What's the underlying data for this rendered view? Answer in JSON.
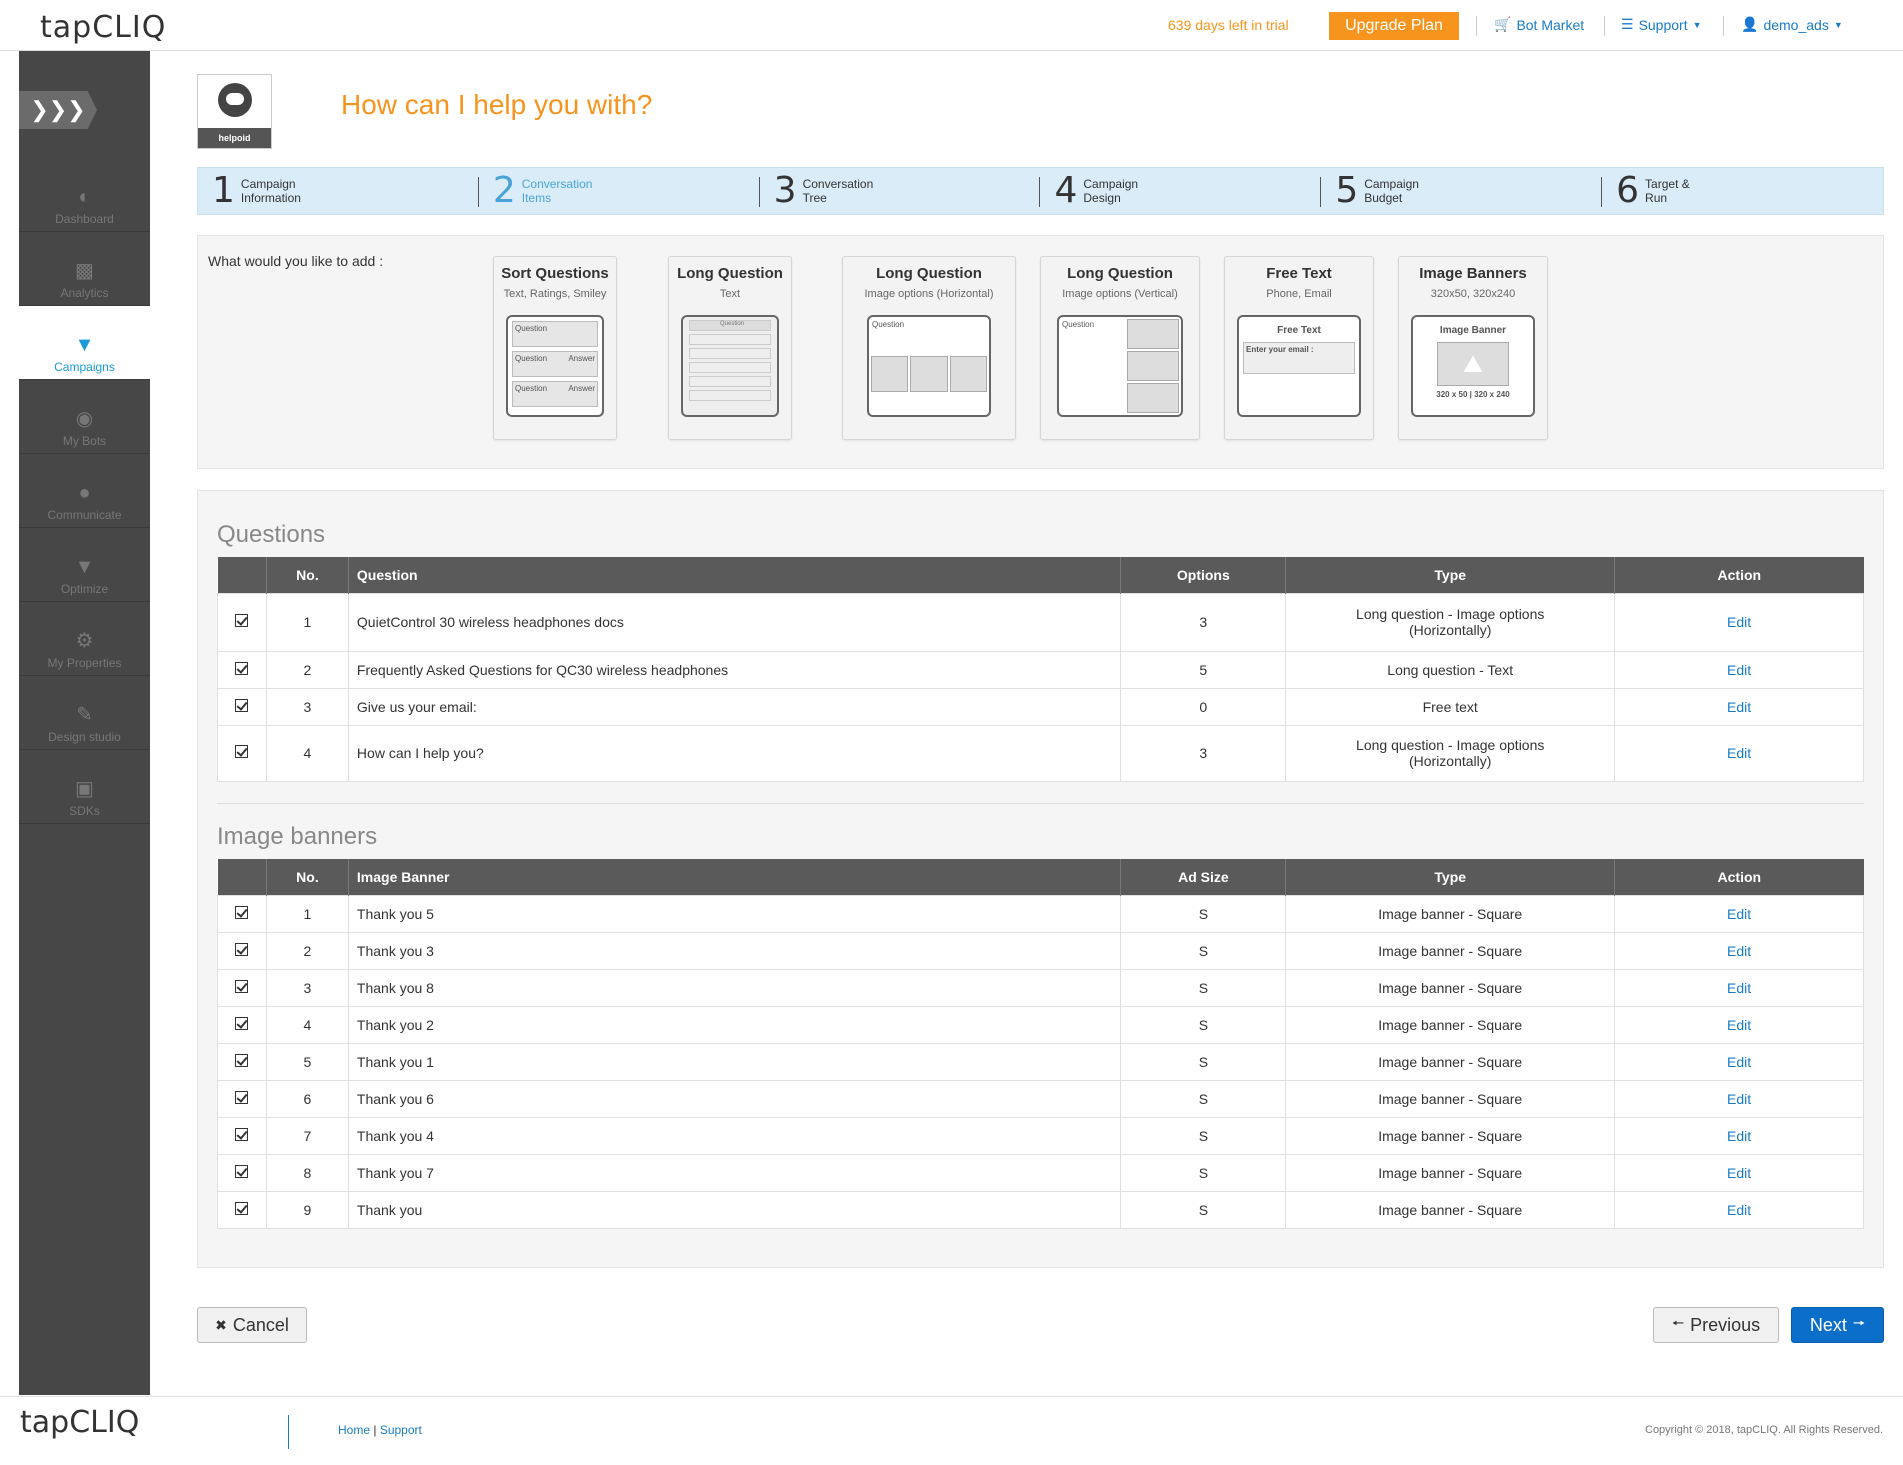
{
  "header": {
    "logo": "tapCLIQ",
    "trial_text": "639 days left in trial",
    "upgrade_label": "Upgrade Plan",
    "bot_market": "Bot Market",
    "support": "Support",
    "user": "demo_ads"
  },
  "sidebar": {
    "items": [
      {
        "label": "Dashboard",
        "icon": "dashboard-icon"
      },
      {
        "label": "Analytics",
        "icon": "analytics-icon"
      },
      {
        "label": "Campaigns",
        "icon": "campaigns-icon"
      },
      {
        "label": "My Bots",
        "icon": "bots-icon"
      },
      {
        "label": "Communicate",
        "icon": "communicate-icon"
      },
      {
        "label": "Optimize",
        "icon": "optimize-icon"
      },
      {
        "label": "My Properties",
        "icon": "properties-icon"
      },
      {
        "label": "Design studio",
        "icon": "design-icon"
      },
      {
        "label": "SDKs",
        "icon": "sdk-icon"
      }
    ]
  },
  "avatar": {
    "label": "helpoid"
  },
  "page_title": "How can I help you with?",
  "steps": [
    {
      "n": "1",
      "l1": "Campaign",
      "l2": "Information"
    },
    {
      "n": "2",
      "l1": "Conversation",
      "l2": "Items"
    },
    {
      "n": "3",
      "l1": "Conversation",
      "l2": "Tree"
    },
    {
      "n": "4",
      "l1": "Campaign",
      "l2": "Design"
    },
    {
      "n": "5",
      "l1": "Campaign",
      "l2": "Budget"
    },
    {
      "n": "6",
      "l1": "Target &",
      "l2": "Run"
    }
  ],
  "add": {
    "label": "What would you like to add :",
    "cards": [
      {
        "title": "Sort Questions",
        "sub": "Text, Ratings, Smiley"
      },
      {
        "title": "Long Question",
        "sub": "Text"
      },
      {
        "title": "Long Question",
        "sub": "Image options (Horizontal)"
      },
      {
        "title": "Long Question",
        "sub": "Image options (Vertical)"
      },
      {
        "title": "Free Text",
        "sub": "Phone, Email"
      },
      {
        "title": "Image Banners",
        "sub": "320x50, 320x240"
      }
    ],
    "thumb_text": {
      "question": "Question",
      "answer": "Answer",
      "free_text": "Free Text",
      "enter_email": "Enter your email :",
      "image_banner": "Image Banner",
      "banner_size": "320 x 50 | 320 x 240"
    }
  },
  "questions": {
    "title": "Questions",
    "headers": [
      "",
      "No.",
      "Question",
      "Options",
      "Type",
      "Action"
    ],
    "rows": [
      {
        "no": "1",
        "q": "QuietControl 30 wireless headphones docs",
        "opt": "3",
        "type": "Long question - Image options (Horizontally)",
        "action": "Edit"
      },
      {
        "no": "2",
        "q": "Frequently Asked Questions for QC30 wireless headphones",
        "opt": "5",
        "type": "Long question - Text",
        "action": "Edit"
      },
      {
        "no": "3",
        "q": "Give us your email:",
        "opt": "0",
        "type": "Free text",
        "action": "Edit"
      },
      {
        "no": "4",
        "q": "How can I help you?",
        "opt": "3",
        "type": "Long question - Image options (Horizontally)",
        "action": "Edit"
      }
    ]
  },
  "banners": {
    "title": "Image banners",
    "headers": [
      "",
      "No.",
      "Image Banner",
      "Ad Size",
      "Type",
      "Action"
    ],
    "rows": [
      {
        "no": "1",
        "name": "Thank you 5",
        "size": "S",
        "type": "Image banner - Square",
        "action": "Edit"
      },
      {
        "no": "2",
        "name": "Thank you 3",
        "size": "S",
        "type": "Image banner - Square",
        "action": "Edit"
      },
      {
        "no": "3",
        "name": "Thank you 8",
        "size": "S",
        "type": "Image banner - Square",
        "action": "Edit"
      },
      {
        "no": "4",
        "name": "Thank you 2",
        "size": "S",
        "type": "Image banner - Square",
        "action": "Edit"
      },
      {
        "no": "5",
        "name": "Thank you 1",
        "size": "S",
        "type": "Image banner - Square",
        "action": "Edit"
      },
      {
        "no": "6",
        "name": "Thank you 6",
        "size": "S",
        "type": "Image banner - Square",
        "action": "Edit"
      },
      {
        "no": "7",
        "name": "Thank you 4",
        "size": "S",
        "type": "Image banner - Square",
        "action": "Edit"
      },
      {
        "no": "8",
        "name": "Thank you 7",
        "size": "S",
        "type": "Image banner - Square",
        "action": "Edit"
      },
      {
        "no": "9",
        "name": "Thank you",
        "size": "S",
        "type": "Image banner - Square",
        "action": "Edit"
      }
    ]
  },
  "buttons": {
    "cancel": "Cancel",
    "previous": "Previous",
    "next": "Next"
  },
  "footer": {
    "logo": "tapCLIQ",
    "home": "Home",
    "support": "Support",
    "copyright": "Copyright © 2018, tapCLIQ. All Rights Reserved."
  }
}
